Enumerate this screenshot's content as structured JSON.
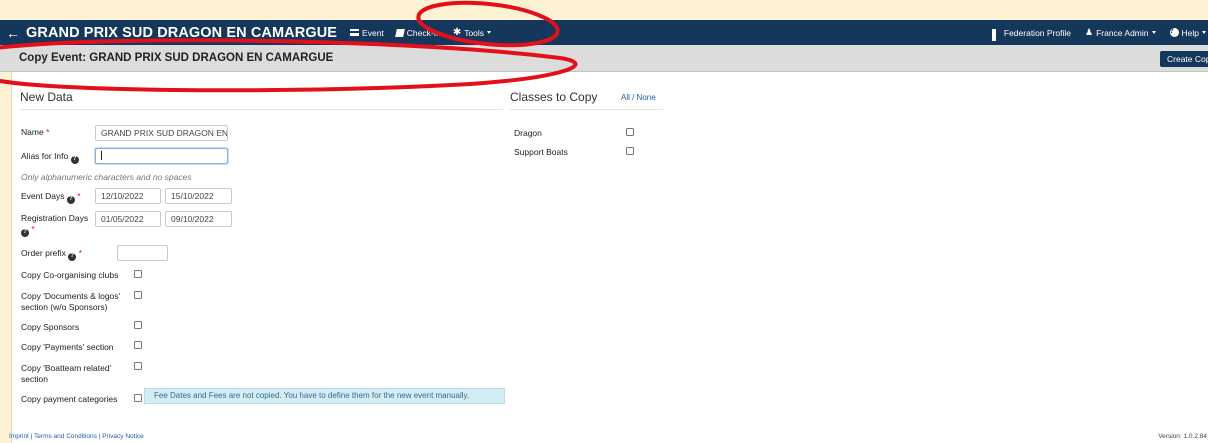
{
  "navbar": {
    "back_glyph": "←",
    "title": "GRAND PRIX SUD DRAGON EN CAMARGUE",
    "event_label": "Event",
    "checkin_label": "Check-In",
    "tools_label": "Tools",
    "federation_profile_label": "Federation Profile",
    "user_label": "France Admin",
    "help_label": "Help"
  },
  "subheader": {
    "title": "Copy Event: GRAND PRIX SUD DRAGON EN CAMARGUE",
    "create_copy_label": "Create Copy"
  },
  "new_data": {
    "heading": "New Data",
    "name_label": "Name",
    "name_value": "GRAND PRIX SUD DRAGON EN CAMARGUE",
    "alias_label": "Alias for Info",
    "alias_value": "",
    "alias_hint": "Only alphanumeric characters and no spaces",
    "event_days_label": "Event Days",
    "event_start": "12/10/2022",
    "event_end": "15/10/2022",
    "registration_days_label": "Registration Days",
    "registration_start": "01/05/2022",
    "registration_end": "09/10/2022",
    "order_prefix_label": "Order prefix",
    "order_prefix_value": "",
    "copy_coorg_label": "Copy Co-organising clubs",
    "copy_docs_label_1": "Copy 'Documents & logos'",
    "copy_docs_label_2": "section (w/o Sponsors)",
    "copy_sponsors_label": "Copy Sponsors",
    "copy_payments_label": "Copy 'Payments' section",
    "copy_boatteam_label_1": "Copy 'Boatteam related'",
    "copy_boatteam_label_2": "section",
    "copy_paycat_label": "Copy payment categories",
    "fee_alert": "Fee Dates and Fees are not copied. You have to define them for the new event manually."
  },
  "classes": {
    "heading": "Classes to Copy",
    "all_none_label": "All / None",
    "items": [
      "Dragon",
      "Support Boats"
    ]
  },
  "footer": {
    "links": "Imprint | Terms and Conditions | Privacy Notice",
    "version": "Version: 1.0.2.84"
  },
  "colors": {
    "navbar": "#15375c",
    "annotation": "#e3101b",
    "background": "#fdf2d3"
  }
}
